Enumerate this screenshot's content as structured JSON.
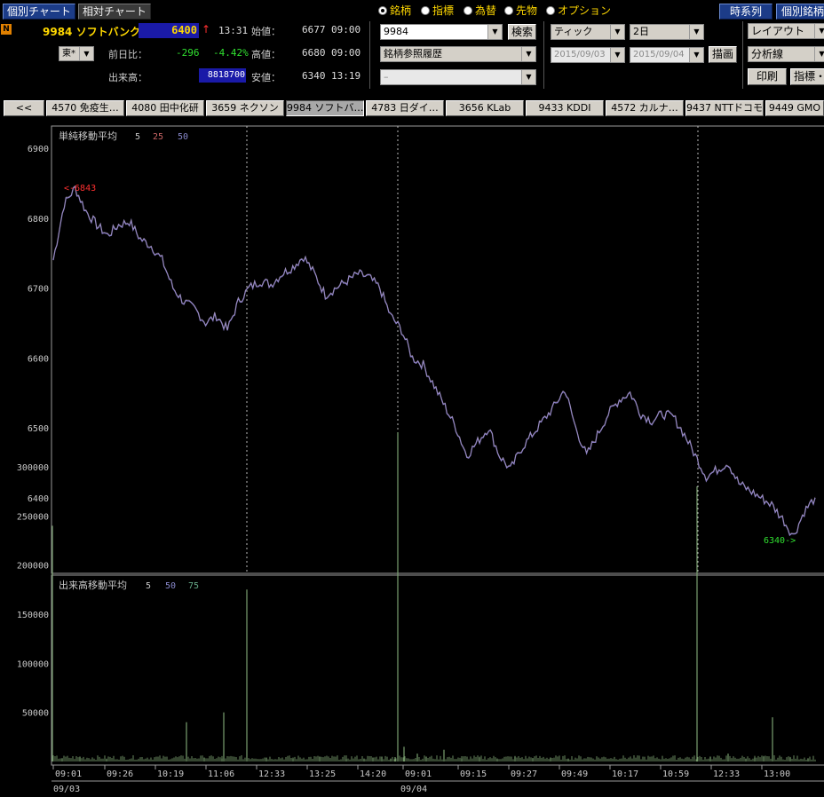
{
  "top_tabs": {
    "individual": "個別チャート",
    "relative": "相対チャート"
  },
  "stock": {
    "badge": "N",
    "code_name": "9984 ソフトバンク",
    "price": "6400",
    "arrow": "↑",
    "time": "13:31",
    "exchange": "東*",
    "prev_label": "前日比：",
    "prev_change": "-296",
    "prev_pct": "-4.42%",
    "volume_label": "出来高：",
    "volume": "8818700",
    "open_label": "始値：",
    "open_val": "6677",
    "open_time": "09:00",
    "high_label": "高値：",
    "high_val": "6680",
    "high_time": "09:00",
    "low_label": "安値：",
    "low_val": "6340",
    "low_time": "13:19"
  },
  "search": {
    "code": "9984",
    "search_button": "検索",
    "history": "銘柄参照履歴",
    "blank": "–"
  },
  "radios": [
    {
      "label": "銘柄",
      "selected": true
    },
    {
      "label": "指標",
      "selected": false
    },
    {
      "label": "為替",
      "selected": false
    },
    {
      "label": "先物",
      "selected": false
    },
    {
      "label": "オプション",
      "selected": false
    }
  ],
  "period": {
    "type": "ティック",
    "span": "2日",
    "from": "2015/09/03",
    "to": "2015/09/04",
    "draw_button": "描画"
  },
  "right_buttons": {
    "timeseries": "時系列",
    "individual_issue": "個別銘柄",
    "layout": "レイアウト",
    "analysis": "分析線",
    "print": "印刷",
    "indicator": "指標・"
  },
  "ticker_tabs": [
    "<<",
    "4570 免疫生…",
    "4080 田中化研",
    "3659 ネクソン",
    "9984 ソフトバ…",
    "4783 日ダイ…",
    "3656 KLab",
    "9433 KDDI",
    "4572 カルナ…",
    "9437 NTTドコモ",
    "9449 GMO"
  ],
  "active_tab_index": 4,
  "price_panel": {
    "title": "単純移動平均",
    "ma": [
      "5",
      "25",
      "50"
    ],
    "ma_colors": [
      "#c8c8c8",
      "#cc6666",
      "#8888cc"
    ],
    "high_marker": "<-6843",
    "low_marker": "6340->",
    "y_ticks": [
      "6900",
      "6800",
      "6700",
      "6600",
      "6500",
      "6400"
    ]
  },
  "volume_panel": {
    "title": "出来高移動平均",
    "ma": [
      "5",
      "50",
      "75"
    ],
    "ma_colors": [
      "#c8c8c8",
      "#8888cc",
      "#66aa88"
    ],
    "y_ticks": [
      "300000",
      "250000",
      "200000",
      "150000",
      "100000",
      "50000"
    ]
  },
  "x_axis": {
    "ticks": [
      "09:01",
      "09:26",
      "10:19",
      "11:06",
      "12:33",
      "13:25",
      "14:20",
      "09:01",
      "09:15",
      "09:27",
      "09:49",
      "10:17",
      "10:59",
      "12:33",
      "13:00"
    ],
    "dates": [
      "09/03",
      "09/04"
    ]
  },
  "chart_data": {
    "type": "line",
    "title": "",
    "series": [
      {
        "values": [
          6740,
          6820,
          6843,
          6810,
          6790,
          6775,
          6790,
          6795,
          6770,
          6760,
          6740,
          6700,
          6680,
          6670,
          6650,
          6660,
          6640,
          6680,
          6700,
          6710,
          6705,
          6720,
          6730,
          6745,
          6720,
          6690,
          6700,
          6710,
          6720,
          6715,
          6700,
          6660,
          6640,
          6600,
          6590,
          6560,
          6530,
          6500,
          6460,
          6480,
          6500,
          6460,
          6440,
          6470,
          6490,
          6510,
          6530,
          6555,
          6500,
          6460,
          6490,
          6520,
          6540,
          6550,
          6520,
          6510,
          6520,
          6515,
          6490,
          6460,
          6430,
          6440,
          6450,
          6420,
          6410,
          6400,
          6390,
          6370,
          6345,
          6380,
          6400
        ]
      }
    ],
    "ylim": [
      6340,
      6930
    ],
    "volume_series": [
      {
        "values": [
          240000,
          3000,
          5000,
          2500,
          40000,
          4000,
          3000,
          50000,
          175000,
          4000,
          3000,
          5000,
          2500,
          3000,
          4000,
          5000,
          3000,
          4500,
          335000,
          15000,
          8000,
          5000,
          12000,
          3000,
          4000,
          2500,
          5000,
          3500,
          4000,
          3000,
          280000,
          5000,
          8000,
          3000,
          4000,
          5000,
          45000,
          4000,
          3000
        ]
      }
    ],
    "volume_ylim": [
      0,
      340000
    ],
    "grid": true
  }
}
